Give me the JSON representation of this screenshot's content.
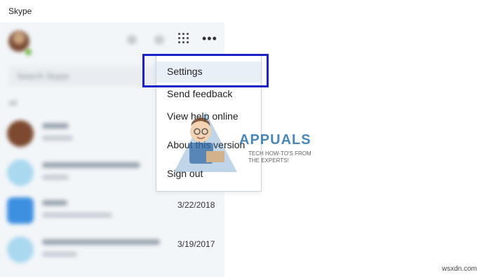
{
  "window": {
    "title": "Skype"
  },
  "sidebar": {
    "search_placeholder": "Search Skype",
    "filter_label": "All",
    "chats": [
      {
        "name": "Contact",
        "preview": "Message",
        "date": "",
        "avatar_color": "#7d4a30"
      },
      {
        "name": "Untitled conversation",
        "preview": "Message",
        "date": "",
        "avatar_color": "#9fd3ee"
      },
      {
        "name": "Skype",
        "preview": "Welcome to Skype",
        "date": "3/22/2018",
        "avatar_color": "#3d8fe0"
      },
      {
        "name": "Echo / Sound Test Service",
        "preview": "Message",
        "date": "3/19/2017",
        "avatar_color": "#9fd3ee"
      }
    ]
  },
  "menu": {
    "items": [
      {
        "label": "Settings"
      },
      {
        "label": "Send feedback"
      },
      {
        "label": "View help online"
      },
      {
        "label": "About this version"
      },
      {
        "label": "Sign out"
      }
    ]
  },
  "watermark": {
    "brand": "APPUALS",
    "tagline": "TECH HOW-TO'S FROM THE EXPERTS!"
  },
  "credit": "wsxdn.com",
  "colors": {
    "highlight": "#1b23c8",
    "sidebar_bg": "#f3f6f9",
    "menu_selected": "#e7eff7"
  }
}
